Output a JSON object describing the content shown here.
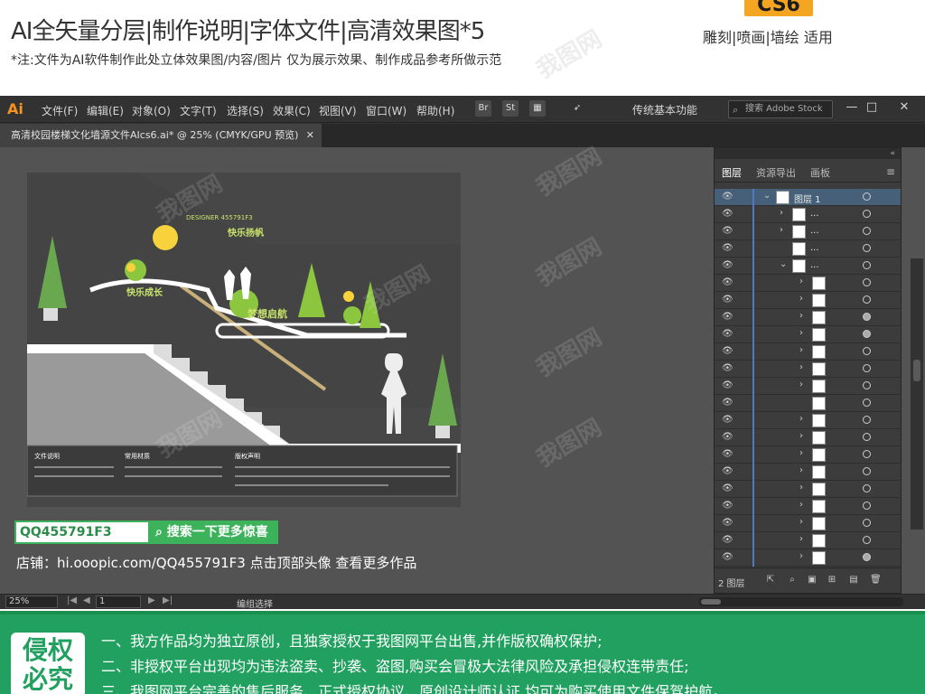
{
  "header": {
    "title": "AI全矢量分层|制作说明|字体文件|高清效果图*5",
    "note": "*注:文件为AI软件制作此处立体效果图/内容/图片 仅为展示效果、制作成品参考所做示范",
    "badge": "CS6",
    "tags": "雕刻|喷画|墙绘 适用"
  },
  "app": {
    "logo": "Ai",
    "menus": [
      "文件(F)",
      "编辑(E)",
      "对象(O)",
      "文字(T)",
      "选择(S)",
      "效果(C)",
      "视图(V)",
      "窗口(W)",
      "帮助(H)"
    ],
    "toolbar_icons": {
      "br": "Br",
      "st": "St"
    },
    "workspace": "传统基本功能",
    "stock_placeholder": "搜索 Adobe Stock",
    "window_controls": [
      "—",
      "□",
      "✕"
    ]
  },
  "document_tab": {
    "title": "高清校园楼梯文化墙源文件AIcs6.ai* @ 25% (CMYK/GPU 预览)",
    "close": "✕"
  },
  "artwork": {
    "designer": "DESIGNER 455791F3",
    "slogan1": "快乐成长",
    "slogan2": "快乐扬帆",
    "slogan3": "梦想启航",
    "info_titles": [
      "文件说明",
      "常用材质",
      "版权声明"
    ]
  },
  "layers_panel": {
    "tabs": [
      "图层",
      "资源导出",
      "画板"
    ],
    "collapse": "«",
    "layer1_name": "图层 1",
    "sublayer_name": "...",
    "count_label": "2 图层",
    "eye": "👁"
  },
  "statusbar": {
    "zoom": "25%",
    "page": "1",
    "label": "编组选择"
  },
  "promo": {
    "qq": "QQ455791F3",
    "search_btn": "搜索一下更多惊喜",
    "shop": "店铺：hi.ooopic.com/QQ455791F3  点击顶部头像 查看更多作品"
  },
  "banner": {
    "badge": "侵权必究",
    "lines": [
      "一、我方作品均为独立原创，且独家授权于我图网平台出售,并作版权确权保护;",
      "二、非授权平台出现均为违法盗卖、抄袭、盗图,购买会冒极大法律风险及承担侵权连带责任;",
      "三、我图网平台完善的售后服务、正式授权协议、原创设计师认证,均可为购买使用文件保驾护航。"
    ]
  },
  "watermark": "我图网"
}
